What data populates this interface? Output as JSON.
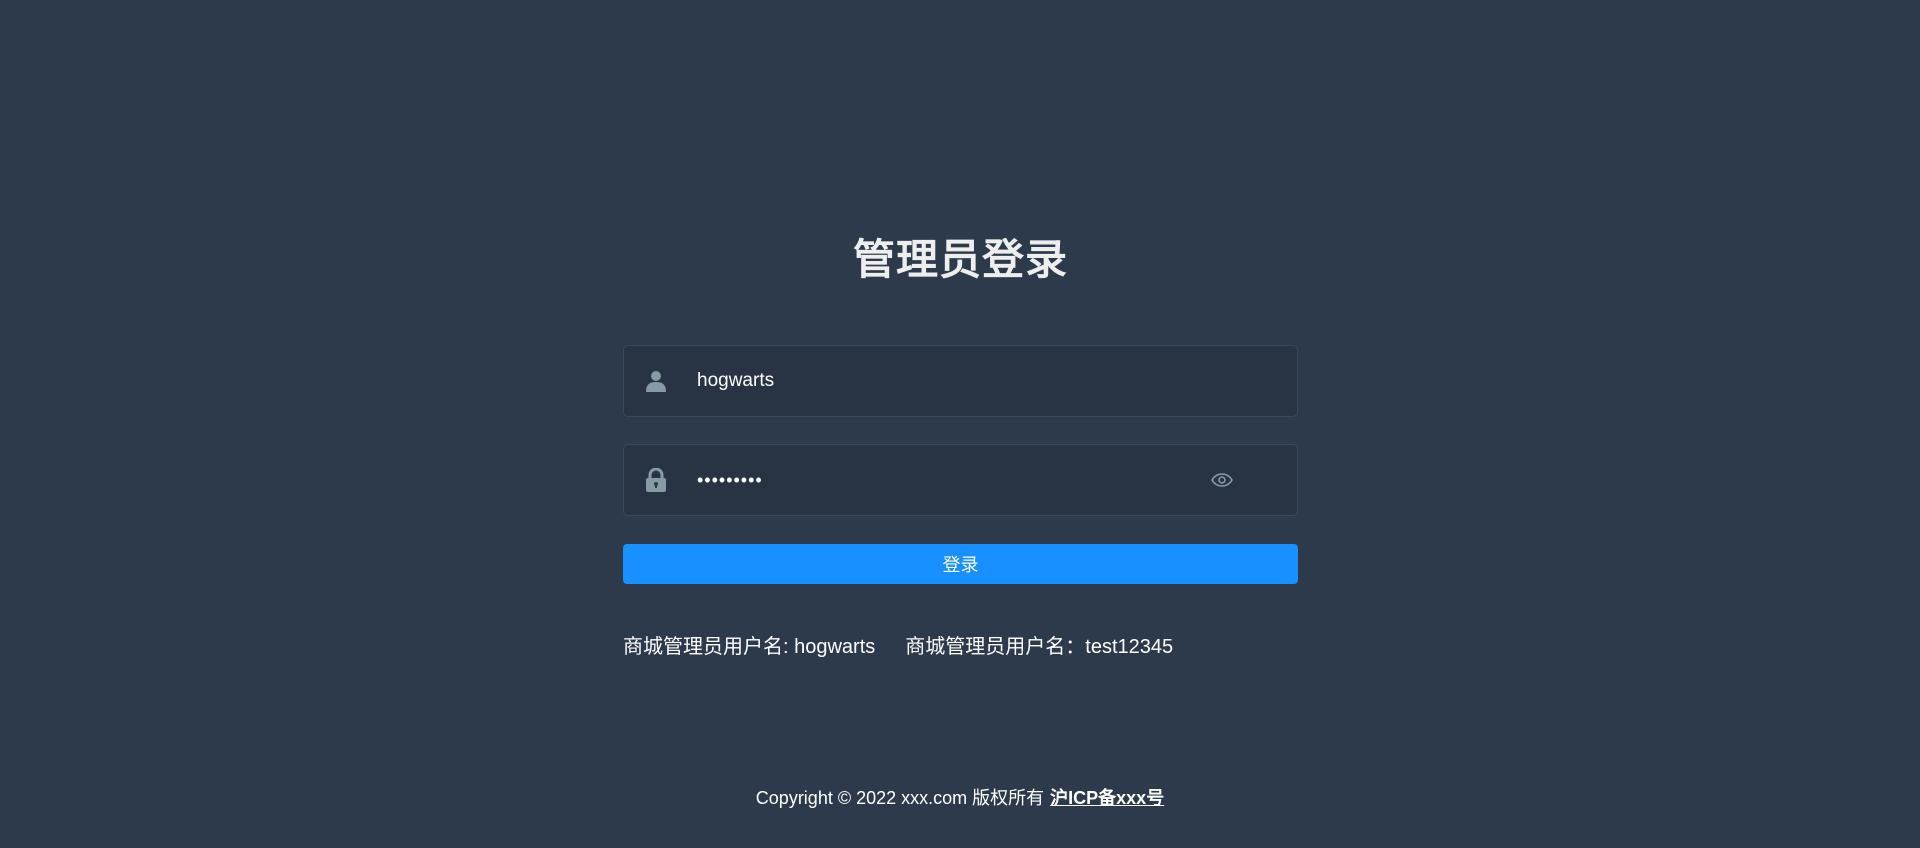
{
  "login": {
    "title": "管理员登录",
    "username": {
      "value": "hogwarts",
      "icon": "user-icon"
    },
    "password": {
      "value": "•••••••••",
      "icon": "lock-icon",
      "toggle_icon": "eye-icon"
    },
    "submit_label": "登录"
  },
  "tips": {
    "line1": "商城管理员用户名: hogwarts",
    "line2": "商城管理员用户名：test12345"
  },
  "footer": {
    "copyright": "Copyright © 2022 xxx.com 版权所有",
    "icp_link": "沪ICP备xxx号"
  },
  "colors": {
    "background": "#2d3a4b",
    "button": "#1890ff",
    "icon": "#889aa4",
    "title": "#eeeeee"
  }
}
